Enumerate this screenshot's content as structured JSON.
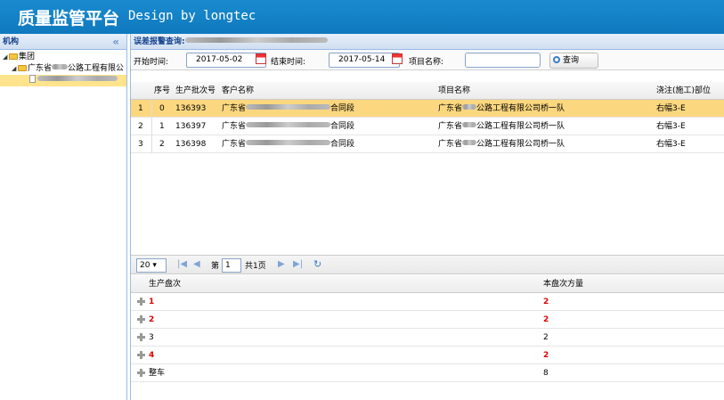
{
  "header": {
    "title": "质量监管平台",
    "subtitle": "Design by longtec"
  },
  "sidebar": {
    "title": "机构",
    "collapse_glyph": "«",
    "tree": [
      {
        "label": "集团",
        "level": 0
      },
      {
        "label_prefix": "广东省",
        "label_suffix": "公路工程有限公",
        "level": 1
      }
    ]
  },
  "panel": {
    "title": "误差报警查询:"
  },
  "search": {
    "start_label": "开始时间:",
    "start_value": "2017-05-02",
    "end_label": "结束时间:",
    "end_value": "2017-05-14",
    "project_label": "项目名称:",
    "project_value": "",
    "query_label": "查询"
  },
  "grid": {
    "columns": [
      "序号",
      "生产批次号",
      "客户名称",
      "项目名称",
      "浇注(施工)部位"
    ],
    "rows": [
      {
        "idx": "1",
        "seq": "0",
        "batch": "136393",
        "client_prefix": "广东省",
        "client_suffix": "合同段",
        "project_prefix": "广东省",
        "project_suffix": "公路工程有限公司桥一队",
        "part": "右幅3-E"
      },
      {
        "idx": "2",
        "seq": "1",
        "batch": "136397",
        "client_prefix": "广东省",
        "client_suffix": "合同段",
        "project_prefix": "广东省",
        "project_suffix": "公路工程有限公司桥一队",
        "part": "右幅3-E"
      },
      {
        "idx": "3",
        "seq": "2",
        "batch": "136398",
        "client_prefix": "广东省",
        "client_suffix": "合同段",
        "project_prefix": "广东省",
        "project_suffix": "公路工程有限公司桥一队",
        "part": "右幅3-E"
      }
    ]
  },
  "pager": {
    "page_size": "20",
    "page_prefix": "第",
    "page_value": "1",
    "page_total": "共1页"
  },
  "subgrid": {
    "columns": [
      "生产盘次",
      "本盘次方量"
    ],
    "rows": [
      {
        "batch": "1",
        "volume": "2",
        "alert": true
      },
      {
        "batch": "2",
        "volume": "2",
        "alert": true
      },
      {
        "batch": "3",
        "volume": "2",
        "alert": false
      },
      {
        "batch": "4",
        "volume": "2",
        "alert": true
      },
      {
        "batch": "整车",
        "volume": "8",
        "alert": false
      }
    ]
  },
  "colors": {
    "header_bg": "#0f79bd",
    "selected_row": "#fbd77f",
    "alert_text": "#dd0000"
  }
}
